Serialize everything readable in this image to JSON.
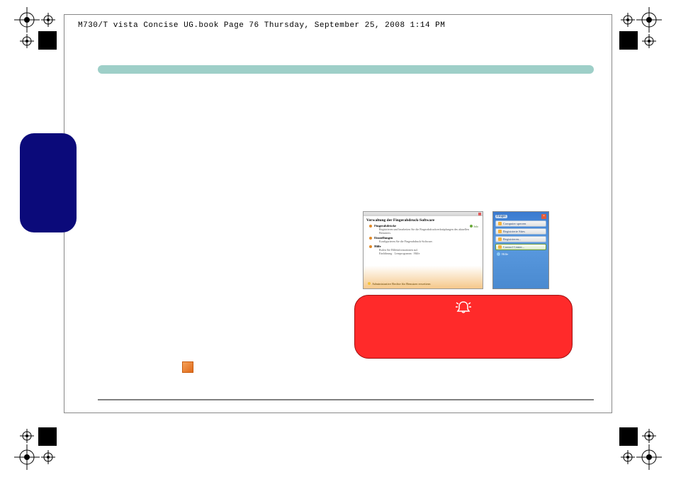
{
  "header": {
    "meta_text": "M730/T vista Concise UG.book  Page 76  Thursday, September 25, 2008  1:14 PM"
  },
  "screenshot1": {
    "window_title": "Verwaltung der Fingerabdruck-Software",
    "info_label": "Info",
    "items": [
      {
        "title": "Fingerabdrücke",
        "desc": "Registrieren und bearbeiten Sie die Fingerabdruckverknüpfungen des aktuellen Benutzers."
      },
      {
        "title": "Einstellungen",
        "desc": "Konfigurieren Sie die Fingerabdruck-Software."
      },
      {
        "title": "Hilfe",
        "desc": "Rufen Sie Hilfeinformationen auf."
      }
    ],
    "sub_items": [
      "Einführung",
      "Lernprogramm",
      "Hilfe"
    ],
    "admin_line": "Administrative Rechte für Benutzer erweitern"
  },
  "screenshot2": {
    "title": "Finger",
    "close": "×",
    "items": [
      {
        "label": "Computer sperren",
        "selected": false
      },
      {
        "label": "Registrierte Sites",
        "selected": false
      },
      {
        "label": "Registrieren...",
        "selected": false
      },
      {
        "label": "Control Center...",
        "selected": true
      }
    ],
    "help_label": "Hilfe",
    "brand": ""
  },
  "red_panel": {
    "icon_glyph": "✧☼✧"
  }
}
